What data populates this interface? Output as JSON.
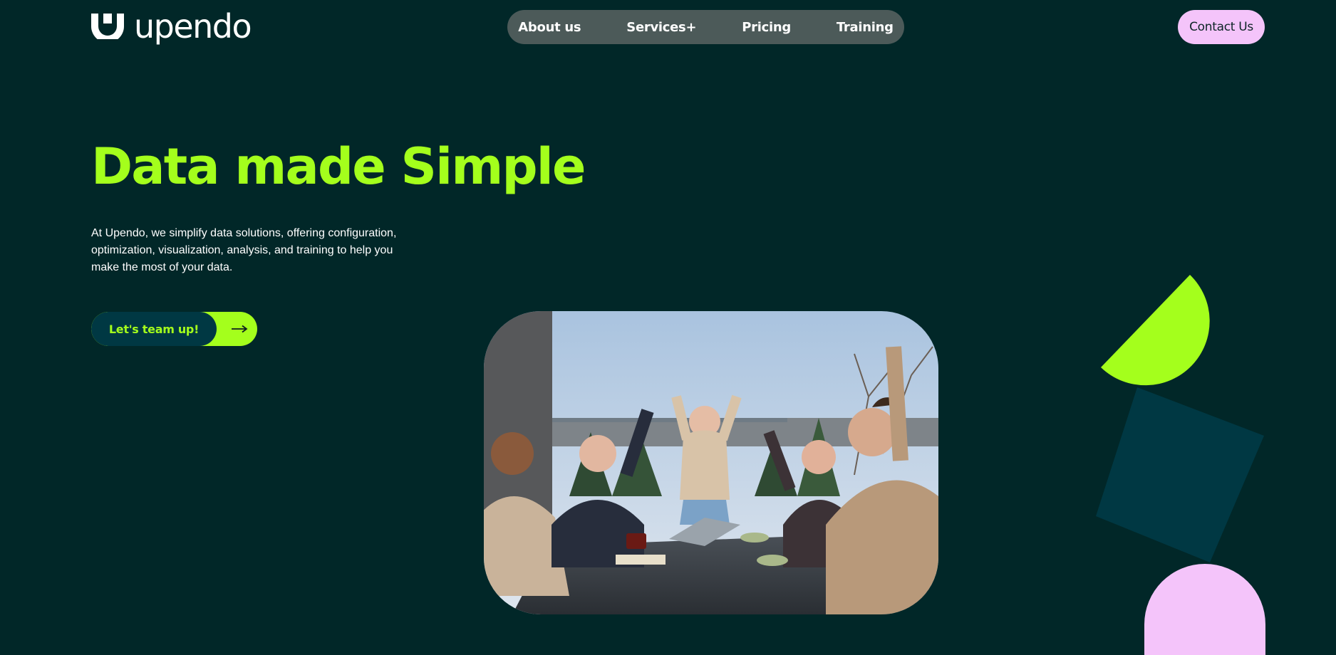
{
  "header": {
    "logo_text": "upendo",
    "logo_icon": "upendo-u-mark-icon",
    "nav": [
      {
        "label": "About us"
      },
      {
        "label": "Services+"
      },
      {
        "label": "Pricing"
      },
      {
        "label": "Training"
      }
    ],
    "contact_label": "Contact Us"
  },
  "hero": {
    "title": "Data made Simple",
    "description": "At Upendo, we simplify data solutions, offering configuration, optimization, visualization, analysis, and training to help you make the most of your data.",
    "cta_label": "Let's team up!",
    "cta_icon": "arrow-right-icon",
    "cta_arrow": "⟶"
  },
  "photo": {
    "icon": "team-celebrating-photo"
  },
  "colors": {
    "background": "#012728",
    "accent_lime": "#a4ff1c",
    "accent_pink": "#f4c4fa",
    "accent_teal": "#003843",
    "nav_pill": "#4c5a59",
    "text": "#ffffff"
  }
}
